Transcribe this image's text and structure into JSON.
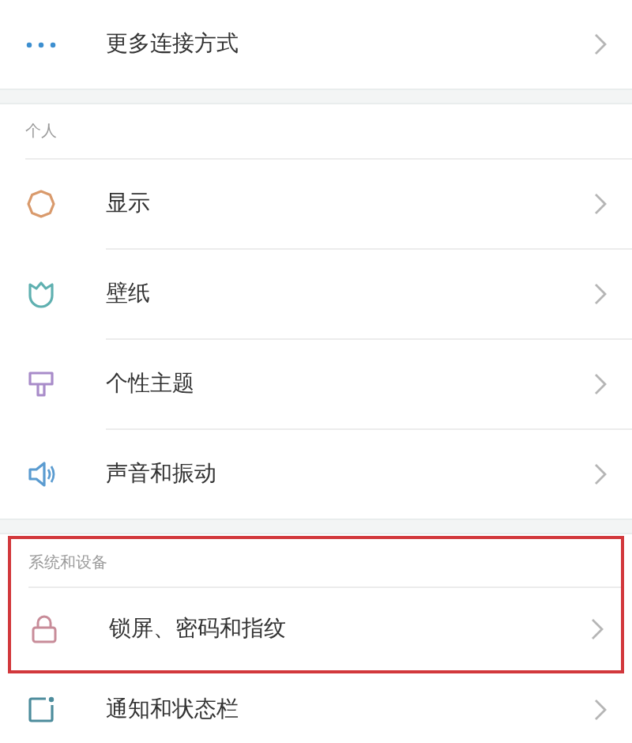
{
  "sections": [
    {
      "highlighted": false,
      "rows": [
        {
          "label": "更多连接方式"
        }
      ]
    },
    {
      "header": "个人",
      "highlighted": false,
      "rows": [
        {
          "label": "显示"
        },
        {
          "label": "壁纸"
        },
        {
          "label": "个性主题"
        },
        {
          "label": "声音和振动"
        }
      ]
    },
    {
      "header": "系统和设备",
      "highlighted": true,
      "rows": [
        {
          "label": "锁屏、密码和指纹"
        }
      ]
    },
    {
      "highlighted": false,
      "rows": [
        {
          "label": "通知和状态栏"
        }
      ]
    }
  ]
}
